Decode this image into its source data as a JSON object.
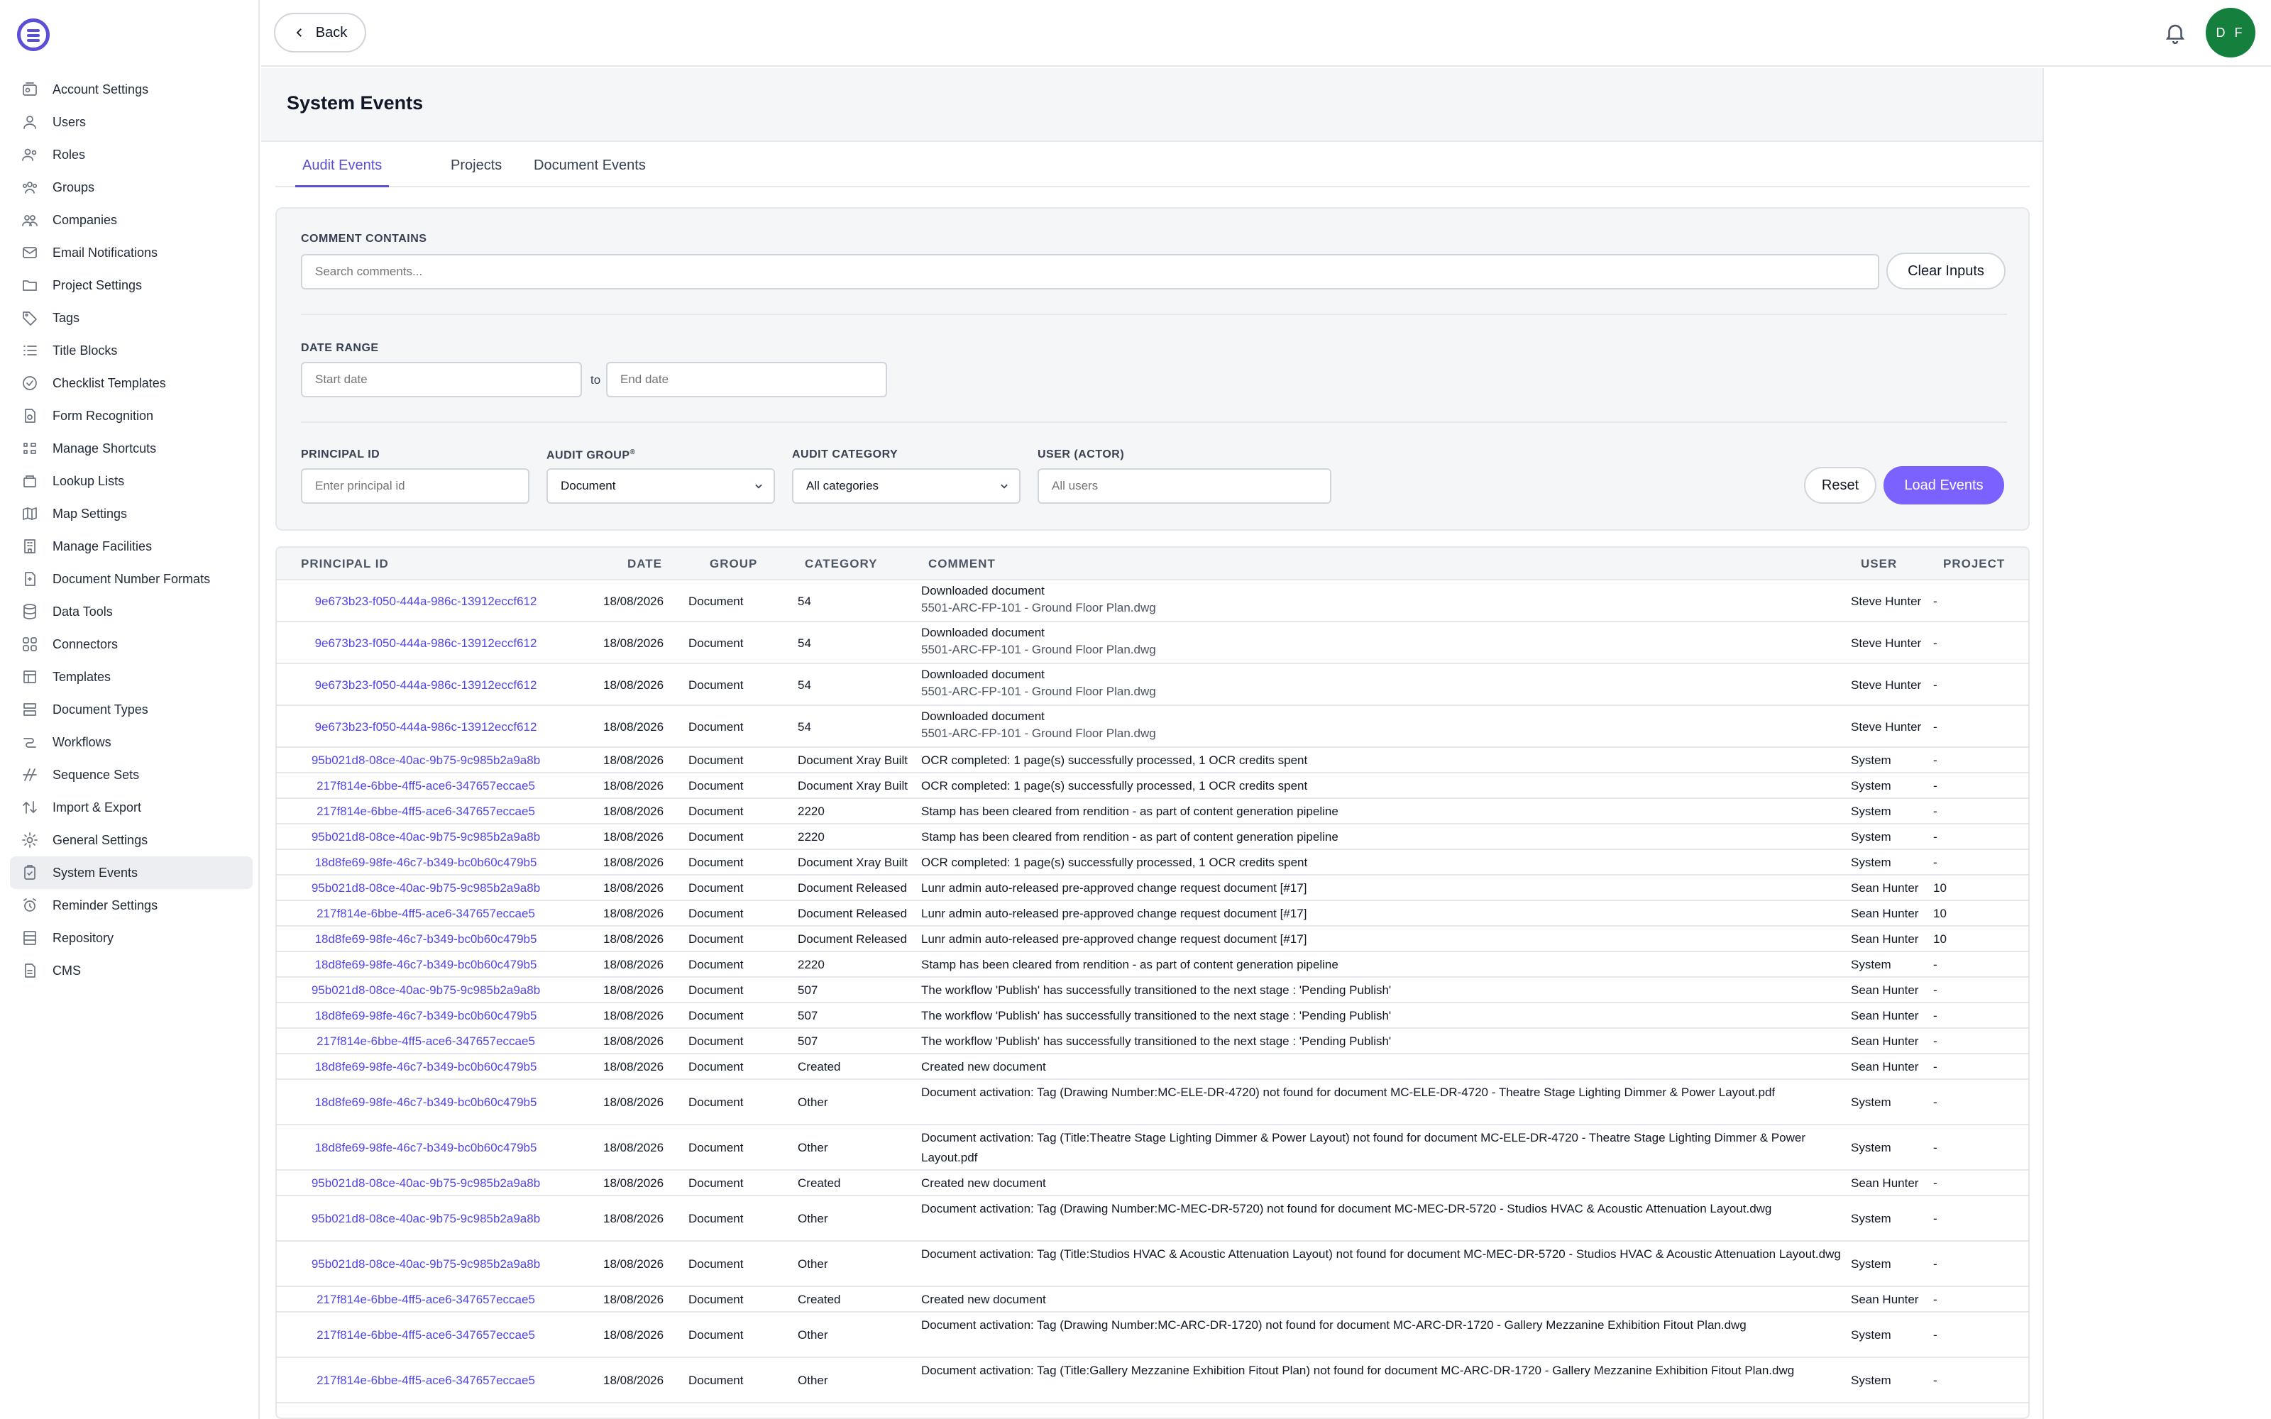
{
  "sidebar": {
    "items": [
      {
        "label": "Account Settings",
        "icon": "settings-box-icon"
      },
      {
        "label": "Users",
        "icon": "user-icon"
      },
      {
        "label": "Roles",
        "icon": "roles-icon"
      },
      {
        "label": "Groups",
        "icon": "group-icon"
      },
      {
        "label": "Companies",
        "icon": "companies-icon"
      },
      {
        "label": "Email Notifications",
        "icon": "envelope-icon"
      },
      {
        "label": "Project Settings",
        "icon": "folder-icon"
      },
      {
        "label": "Tags",
        "icon": "tag-icon"
      },
      {
        "label": "Title Blocks",
        "icon": "list-icon"
      },
      {
        "label": "Checklist Templates",
        "icon": "check-circle-icon"
      },
      {
        "label": "Form Recognition",
        "icon": "form-recognition-icon"
      },
      {
        "label": "Manage Shortcuts",
        "icon": "shortcuts-icon"
      },
      {
        "label": "Lookup Lists",
        "icon": "lookup-icon"
      },
      {
        "label": "Map Settings",
        "icon": "map-icon"
      },
      {
        "label": "Manage Facilities",
        "icon": "building-icon"
      },
      {
        "label": "Document Number Formats",
        "icon": "document-number-icon"
      },
      {
        "label": "Data Tools",
        "icon": "database-icon"
      },
      {
        "label": "Connectors",
        "icon": "connectors-icon"
      },
      {
        "label": "Templates",
        "icon": "templates-icon"
      },
      {
        "label": "Document Types",
        "icon": "document-types-icon"
      },
      {
        "label": "Workflows",
        "icon": "workflow-icon"
      },
      {
        "label": "Sequence Sets",
        "icon": "sequence-icon"
      },
      {
        "label": "Import & Export",
        "icon": "import-export-icon"
      },
      {
        "label": "General Settings",
        "icon": "gear-icon"
      },
      {
        "label": "System Events",
        "icon": "clipboard-icon",
        "active": true
      },
      {
        "label": "Reminder Settings",
        "icon": "alarm-icon"
      },
      {
        "label": "Repository",
        "icon": "repository-icon"
      },
      {
        "label": "CMS",
        "icon": "cms-icon"
      }
    ]
  },
  "topbar": {
    "back_label": "Back",
    "avatar_initials": "D F"
  },
  "page": {
    "title": "System Events",
    "tabs": [
      "Audit Events",
      "Projects",
      "Document Events"
    ]
  },
  "filters": {
    "comment_label": "COMMENT CONTAINS",
    "comment_placeholder": "Search comments...",
    "clear_label": "Clear Inputs",
    "date_label": "DATE RANGE",
    "start_placeholder": "Start date",
    "to_label": "to",
    "end_placeholder": "End date",
    "principal_label": "PRINCIPAL ID",
    "principal_placeholder": "Enter principal id",
    "group_label": "AUDIT GROUP",
    "group_required": "®",
    "group_value": "Document",
    "category_label": "AUDIT CATEGORY",
    "category_value": "All categories",
    "user_label": "USER (ACTOR)",
    "user_placeholder": "All users",
    "reset_label": "Reset",
    "load_label": "Load Events"
  },
  "table": {
    "headers": [
      "PRINCIPAL ID",
      "DATE",
      "GROUP",
      "CATEGORY",
      "COMMENT",
      "USER",
      "PROJECT"
    ],
    "rows": [
      {
        "pid": "9e673b23-f050-444a-986c-13912eccf612",
        "date": "18/08/2026",
        "group": "Document",
        "category": "54",
        "comment": [
          "Downloaded document",
          "5501-ARC-FP-101 - Ground Floor Plan.dwg"
        ],
        "user": "Steve Hunter",
        "project": "-"
      },
      {
        "pid": "9e673b23-f050-444a-986c-13912eccf612",
        "date": "18/08/2026",
        "group": "Document",
        "category": "54",
        "comment": [
          "Downloaded document",
          "5501-ARC-FP-101 - Ground Floor Plan.dwg"
        ],
        "user": "Steve Hunter",
        "project": "-"
      },
      {
        "pid": "9e673b23-f050-444a-986c-13912eccf612",
        "date": "18/08/2026",
        "group": "Document",
        "category": "54",
        "comment": [
          "Downloaded document",
          "5501-ARC-FP-101 - Ground Floor Plan.dwg"
        ],
        "user": "Steve Hunter",
        "project": "-"
      },
      {
        "pid": "9e673b23-f050-444a-986c-13912eccf612",
        "date": "18/08/2026",
        "group": "Document",
        "category": "54",
        "comment": [
          "Downloaded document",
          "5501-ARC-FP-101 - Ground Floor Plan.dwg"
        ],
        "user": "Steve Hunter",
        "project": "-"
      },
      {
        "pid": "95b021d8-08ce-40ac-9b75-9c985b2a9a8b",
        "date": "18/08/2026",
        "group": "Document",
        "category": "Document Xray Built",
        "comment": [
          "OCR completed: 1 page(s) successfully processed, 1 OCR credits spent"
        ],
        "user": "System",
        "project": "-"
      },
      {
        "pid": "217f814e-6bbe-4ff5-ace6-347657eccae5",
        "date": "18/08/2026",
        "group": "Document",
        "category": "Document Xray Built",
        "comment": [
          "OCR completed: 1 page(s) successfully processed, 1 OCR credits spent"
        ],
        "user": "System",
        "project": "-"
      },
      {
        "pid": "217f814e-6bbe-4ff5-ace6-347657eccae5",
        "date": "18/08/2026",
        "group": "Document",
        "category": "2220",
        "comment": [
          "Stamp has been cleared from rendition - as part of content generation pipeline"
        ],
        "user": "System",
        "project": "-"
      },
      {
        "pid": "95b021d8-08ce-40ac-9b75-9c985b2a9a8b",
        "date": "18/08/2026",
        "group": "Document",
        "category": "2220",
        "comment": [
          "Stamp has been cleared from rendition - as part of content generation pipeline"
        ],
        "user": "System",
        "project": "-"
      },
      {
        "pid": "18d8fe69-98fe-46c7-b349-bc0b60c479b5",
        "date": "18/08/2026",
        "group": "Document",
        "category": "Document Xray Built",
        "comment": [
          "OCR completed: 1 page(s) successfully processed, 1 OCR credits spent"
        ],
        "user": "System",
        "project": "-"
      },
      {
        "pid": "95b021d8-08ce-40ac-9b75-9c985b2a9a8b",
        "date": "18/08/2026",
        "group": "Document",
        "category": "Document Released",
        "comment": [
          "Lunr admin auto-released pre-approved change request document [#17]"
        ],
        "user": "Sean Hunter",
        "project": "10"
      },
      {
        "pid": "217f814e-6bbe-4ff5-ace6-347657eccae5",
        "date": "18/08/2026",
        "group": "Document",
        "category": "Document Released",
        "comment": [
          "Lunr admin auto-released pre-approved change request document [#17]"
        ],
        "user": "Sean Hunter",
        "project": "10"
      },
      {
        "pid": "18d8fe69-98fe-46c7-b349-bc0b60c479b5",
        "date": "18/08/2026",
        "group": "Document",
        "category": "Document Released",
        "comment": [
          "Lunr admin auto-released pre-approved change request document [#17]"
        ],
        "user": "Sean Hunter",
        "project": "10"
      },
      {
        "pid": "18d8fe69-98fe-46c7-b349-bc0b60c479b5",
        "date": "18/08/2026",
        "group": "Document",
        "category": "2220",
        "comment": [
          "Stamp has been cleared from rendition - as part of content generation pipeline"
        ],
        "user": "System",
        "project": "-"
      },
      {
        "pid": "95b021d8-08ce-40ac-9b75-9c985b2a9a8b",
        "date": "18/08/2026",
        "group": "Document",
        "category": "507",
        "comment": [
          "The workflow 'Publish' has successfully transitioned to the next stage : 'Pending Publish'"
        ],
        "user": "Sean Hunter",
        "project": "-"
      },
      {
        "pid": "18d8fe69-98fe-46c7-b349-bc0b60c479b5",
        "date": "18/08/2026",
        "group": "Document",
        "category": "507",
        "comment": [
          "The workflow 'Publish' has successfully transitioned to the next stage : 'Pending Publish'"
        ],
        "user": "Sean Hunter",
        "project": "-"
      },
      {
        "pid": "217f814e-6bbe-4ff5-ace6-347657eccae5",
        "date": "18/08/2026",
        "group": "Document",
        "category": "507",
        "comment": [
          "The workflow 'Publish' has successfully transitioned to the next stage : 'Pending Publish'"
        ],
        "user": "Sean Hunter",
        "project": "-"
      },
      {
        "pid": "18d8fe69-98fe-46c7-b349-bc0b60c479b5",
        "date": "18/08/2026",
        "group": "Document",
        "category": "Created",
        "comment": [
          "Created new document"
        ],
        "user": "Sean Hunter",
        "project": "-"
      },
      {
        "pid": "18d8fe69-98fe-46c7-b349-bc0b60c479b5",
        "date": "18/08/2026",
        "group": "Document",
        "category": "Other",
        "comment": [
          "Document activation: Tag (Drawing Number:MC-ELE-DR-4720) not found for document MC-ELE-DR-4720 - Theatre Stage Lighting Dimmer & Power Layout.pdf"
        ],
        "user": "System",
        "project": "-"
      },
      {
        "pid": "18d8fe69-98fe-46c7-b349-bc0b60c479b5",
        "date": "18/08/2026",
        "group": "Document",
        "category": "Other",
        "comment": [
          "Document activation: Tag (Title:Theatre Stage Lighting Dimmer & Power Layout) not found for document MC-ELE-DR-4720 - Theatre Stage Lighting Dimmer & Power Layout.pdf"
        ],
        "user": "System",
        "project": "-"
      },
      {
        "pid": "95b021d8-08ce-40ac-9b75-9c985b2a9a8b",
        "date": "18/08/2026",
        "group": "Document",
        "category": "Created",
        "comment": [
          "Created new document"
        ],
        "user": "Sean Hunter",
        "project": "-"
      },
      {
        "pid": "95b021d8-08ce-40ac-9b75-9c985b2a9a8b",
        "date": "18/08/2026",
        "group": "Document",
        "category": "Other",
        "comment": [
          "Document activation: Tag (Drawing Number:MC-MEC-DR-5720) not found for document MC-MEC-DR-5720 - Studios HVAC & Acoustic Attenuation Layout.dwg"
        ],
        "user": "System",
        "project": "-"
      },
      {
        "pid": "95b021d8-08ce-40ac-9b75-9c985b2a9a8b",
        "date": "18/08/2026",
        "group": "Document",
        "category": "Other",
        "comment": [
          "Document activation: Tag (Title:Studios HVAC & Acoustic Attenuation Layout) not found for document MC-MEC-DR-5720 - Studios HVAC & Acoustic Attenuation Layout.dwg"
        ],
        "user": "System",
        "project": "-"
      },
      {
        "pid": "217f814e-6bbe-4ff5-ace6-347657eccae5",
        "date": "18/08/2026",
        "group": "Document",
        "category": "Created",
        "comment": [
          "Created new document"
        ],
        "user": "Sean Hunter",
        "project": "-"
      },
      {
        "pid": "217f814e-6bbe-4ff5-ace6-347657eccae5",
        "date": "18/08/2026",
        "group": "Document",
        "category": "Other",
        "comment": [
          "Document activation: Tag (Drawing Number:MC-ARC-DR-1720) not found for document MC-ARC-DR-1720 - Gallery Mezzanine Exhibition Fitout Plan.dwg"
        ],
        "user": "System",
        "project": "-"
      },
      {
        "pid": "217f814e-6bbe-4ff5-ace6-347657eccae5",
        "date": "18/08/2026",
        "group": "Document",
        "category": "Other",
        "comment": [
          "Document activation: Tag (Title:Gallery Mezzanine Exhibition Fitout Plan) not found for document MC-ARC-DR-1720 - Gallery Mezzanine Exhibition Fitout Plan.dwg"
        ],
        "user": "System",
        "project": "-"
      }
    ]
  }
}
